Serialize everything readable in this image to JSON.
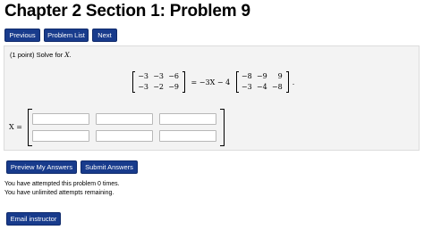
{
  "page_title": "Chapter 2 Section 1: Problem 9",
  "nav": {
    "previous_label": "Previous",
    "problem_list_label": "Problem List",
    "next_label": "Next"
  },
  "problem": {
    "points": "(1 point) Solve for",
    "variable": "X",
    "period": ".",
    "matrix_a": [
      [
        "−3",
        "−3",
        "−6"
      ],
      [
        "−3",
        "−2",
        "−9"
      ]
    ],
    "equals_text": " = −3X − 4 ",
    "matrix_b": [
      [
        "−8",
        "−9",
        "9"
      ],
      [
        "−3",
        "−4",
        "−8"
      ]
    ],
    "answer_label": "X ="
  },
  "answer_inputs": [
    [
      "",
      "",
      ""
    ],
    [
      "",
      "",
      ""
    ]
  ],
  "actions": {
    "preview_label": "Preview My Answers",
    "submit_label": "Submit Answers"
  },
  "status": {
    "attempted": "You have attempted this problem 0 times.",
    "remaining": "You have unlimited attempts remaining."
  },
  "email_label": "Email instructor",
  "colors": {
    "button_bg": "#183b8c",
    "panel_bg": "#f3f3f3"
  }
}
